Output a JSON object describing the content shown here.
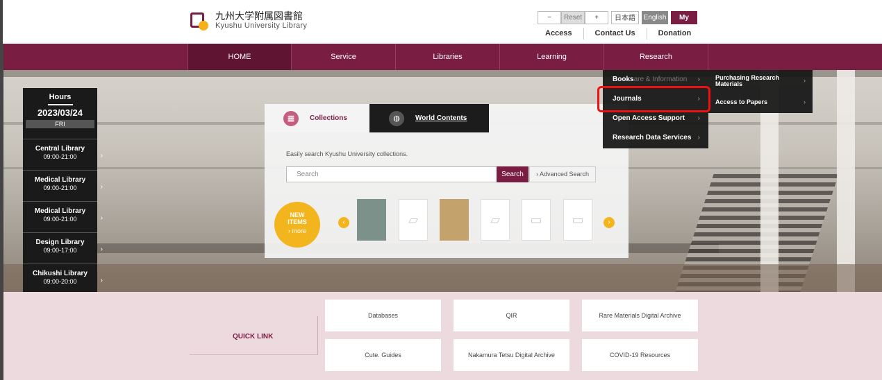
{
  "header": {
    "logo_jp": "九州大学附属図書館",
    "logo_en": "Kyushu University Library",
    "zoom_minus": "−",
    "zoom_reset": "Reset",
    "zoom_plus": "+",
    "lang_ja": "日本語",
    "lang_en": "English",
    "mypage": "My Page",
    "util_links": [
      "Access",
      "Contact Us",
      "Donation"
    ]
  },
  "nav": {
    "items": [
      "HOME",
      "Service",
      "Libraries",
      "Learning",
      "Research"
    ],
    "active": "HOME"
  },
  "hours": {
    "label": "Hours",
    "date": "2023/03/24",
    "day": "FRI",
    "libraries": [
      {
        "name": "Central Library",
        "time": "09:00-21:00"
      },
      {
        "name": "Medical Library",
        "time": "09:00-21:00"
      },
      {
        "name": "Medical Library",
        "time": "09:00-21:00"
      },
      {
        "name": "Design Library",
        "time": "09:00-17:00"
      },
      {
        "name": "Chikushi Library",
        "time": "09:00-20:00"
      }
    ]
  },
  "collections": {
    "tab_collections": "Collections",
    "tab_world": "World Contents",
    "description": "Easily search Kyushu University collections.",
    "search_placeholder": "Search",
    "search_button": "Search",
    "advanced_search": "› Advanced Search",
    "new_items_1": "NEW",
    "new_items_2": "ITEMS",
    "new_items_more": "› more",
    "prev_arrow": "‹",
    "next_arrow": "›",
    "book_icon": "book-placeholder-icon"
  },
  "research_menu": {
    "items": [
      {
        "label": "Books",
        "ghost": "are & Information"
      },
      {
        "label": "Journals",
        "ghost": ""
      },
      {
        "label": "Open Access Support",
        "ghost": ""
      },
      {
        "label": "Research Data Services",
        "ghost": ""
      }
    ],
    "submenu": [
      "Purchasing Research Materials",
      "Access to Papers"
    ]
  },
  "quick_links": {
    "title": "QUICK LINK",
    "row1": [
      "Databases",
      "QIR",
      "Rare Materials Digital Archive"
    ],
    "row2": [
      "Cute. Guides",
      "Nakamura Tetsu Digital Archive",
      "COVID-19 Resources"
    ]
  },
  "colors": {
    "brand": "#7a1d42",
    "accent": "#f2b51e",
    "highlight": "#e11111"
  }
}
